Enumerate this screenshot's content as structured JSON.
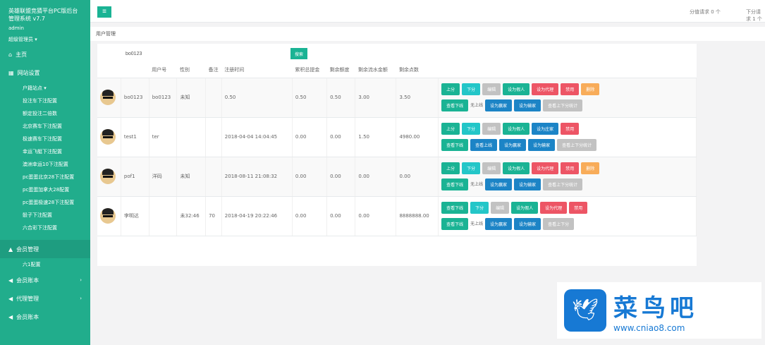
{
  "sidebar": {
    "title": "英雄联盟竞猜平台PC版后台管理系统 v7.7",
    "user": "admin",
    "role": "超级管理员 ▾",
    "items": [
      {
        "label": "主页",
        "icon": "home-icon"
      },
      {
        "label": "网站设置",
        "icon": "grid-icon"
      }
    ],
    "subitems": [
      "户籍站点 ▾",
      "投注车下注配置",
      "额定投注二倍数",
      "北京赛车下注配置",
      "极速赛车下注配置",
      "幸运飞艇下注配置",
      "澳洲幸运10下注配置",
      "pc蛋蛋北京28下注配置",
      "pc蛋蛋加拿大28配置",
      "pc蛋蛋极速28下注配置",
      "骰子下注配置",
      "六合彩下注配置"
    ],
    "bottom": [
      {
        "label": "会员管理",
        "icon": "user-icon"
      },
      {
        "label": "六1配置"
      },
      {
        "label": "会员账本",
        "icon": "send-icon"
      },
      {
        "label": "代理管理",
        "icon": "send-icon"
      },
      {
        "label": "会员账本",
        "icon": "send-icon"
      }
    ]
  },
  "topbar": {
    "menu_icon": "≡",
    "score_requests": "分值请求 0 个",
    "withdraw_requests": "下分请求 1 个"
  },
  "breadcrumb": "用户管理",
  "search": {
    "value": "bo0123",
    "button": "搜索"
  },
  "table": {
    "headers": [
      "",
      "",
      "用户号",
      "性别",
      "备注",
      "注册时间",
      "累积总提金",
      "剩余额度",
      "剩余流水金额",
      "剩余点数",
      ""
    ],
    "rows": [
      {
        "nick": "bo0123",
        "uid": "bo0123",
        "sex": "未知",
        "note": "",
        "reg": "0.50",
        "total": "0.50",
        "quota": "0.50",
        "flow": "3.00",
        "points": "3.50",
        "row2": [
          "查看下线",
          "无上线",
          "设为赢家",
          "设为输家",
          "查看上下分统计"
        ],
        "row1": [
          "上分",
          "下分",
          "编辑",
          "设为假人",
          "设为代理",
          "禁用",
          "删除"
        ]
      },
      {
        "nick": "test1",
        "uid": "ter",
        "sex": "",
        "note": "",
        "reg": "2018-04-04 14:04:45",
        "total": "0.00",
        "quota": "0.00",
        "flow": "1.50",
        "points": "4980.00",
        "row1": [
          "上分",
          "下分",
          "编辑",
          "设为假人",
          "设为庄家",
          "禁用"
        ],
        "row2": [
          "查看下线",
          "查看上线",
          "设为赢家",
          "设为输家",
          "查看上下分统计"
        ]
      },
      {
        "nick": "pof1",
        "uid": "洋码",
        "sex": "未知",
        "note": "",
        "reg": "2018-08-11 21:08:32",
        "total": "0.00",
        "quota": "0.00",
        "flow": "0.00",
        "points": "0.00",
        "row1": [
          "上分",
          "下分",
          "编辑",
          "设为假人",
          "设为代理",
          "禁用",
          "删除"
        ],
        "row2": [
          "查看下线",
          "无上线",
          "设为赢家",
          "设为输家",
          "查看上下分统计"
        ]
      },
      {
        "nick": "李明达",
        "uid": "",
        "sex": "未32:46",
        "note": "70",
        "reg": "2018-04-19 20:22:46",
        "total": "0.00",
        "quota": "0.00",
        "flow": "0.00",
        "points": "8888888.00",
        "row1": [
          "查看下线",
          "下分",
          "编辑",
          "设为假人",
          "设为代理",
          "禁用"
        ],
        "row2": [
          "查看下线",
          "无上线",
          "设为赢家",
          "设为输家",
          "查看上下分"
        ]
      }
    ]
  },
  "watermark": {
    "name": "菜鸟吧",
    "url": "www.cniao8.com"
  }
}
